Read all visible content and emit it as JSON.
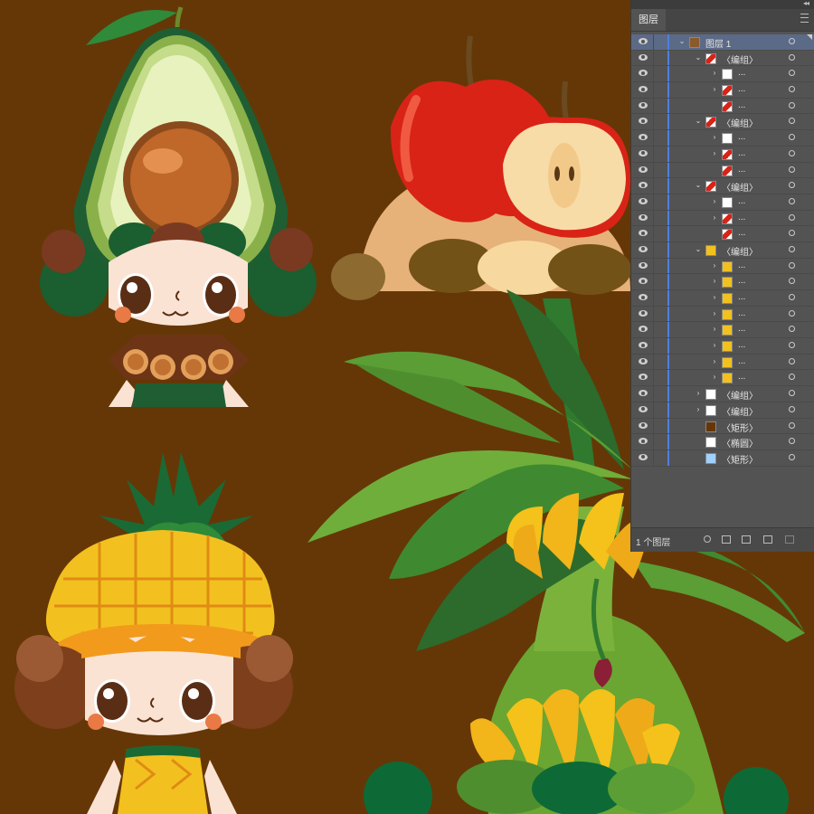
{
  "app": {
    "name": "illustrator-canvas"
  },
  "colors": {
    "background": "#653707",
    "panel": "#535353",
    "accent": "#4f7fe0"
  },
  "layers_panel": {
    "tab_label": "图层",
    "footer_label": "1 个图层",
    "rows": [
      {
        "label": "图层 1",
        "indent": 0,
        "expand": "v",
        "thumb": "layer",
        "top": true
      },
      {
        "label": "〈编组〉",
        "indent": 1,
        "expand": "v",
        "thumb": "red"
      },
      {
        "label": "...",
        "indent": 2,
        "expand": ">",
        "thumb": "white"
      },
      {
        "label": "...",
        "indent": 2,
        "expand": ">",
        "thumb": "red"
      },
      {
        "label": "...",
        "indent": 2,
        "expand": "",
        "thumb": "red"
      },
      {
        "label": "〈编组〉",
        "indent": 1,
        "expand": "v",
        "thumb": "red"
      },
      {
        "label": "...",
        "indent": 2,
        "expand": ">",
        "thumb": "white"
      },
      {
        "label": "...",
        "indent": 2,
        "expand": ">",
        "thumb": "red"
      },
      {
        "label": "...",
        "indent": 2,
        "expand": "",
        "thumb": "red"
      },
      {
        "label": "〈编组〉",
        "indent": 1,
        "expand": "v",
        "thumb": "red"
      },
      {
        "label": "...",
        "indent": 2,
        "expand": ">",
        "thumb": "white"
      },
      {
        "label": "...",
        "indent": 2,
        "expand": ">",
        "thumb": "red"
      },
      {
        "label": "...",
        "indent": 2,
        "expand": "",
        "thumb": "red"
      },
      {
        "label": "〈编组〉",
        "indent": 1,
        "expand": "v",
        "thumb": "char"
      },
      {
        "label": "...",
        "indent": 2,
        "expand": ">",
        "thumb": "char"
      },
      {
        "label": "...",
        "indent": 2,
        "expand": ">",
        "thumb": "char"
      },
      {
        "label": "...",
        "indent": 2,
        "expand": ">",
        "thumb": "char"
      },
      {
        "label": "...",
        "indent": 2,
        "expand": ">",
        "thumb": "char"
      },
      {
        "label": "...",
        "indent": 2,
        "expand": ">",
        "thumb": "char"
      },
      {
        "label": "...",
        "indent": 2,
        "expand": ">",
        "thumb": "char"
      },
      {
        "label": "...",
        "indent": 2,
        "expand": ">",
        "thumb": "char"
      },
      {
        "label": "...",
        "indent": 2,
        "expand": ">",
        "thumb": "char"
      },
      {
        "label": "〈编组〉",
        "indent": 1,
        "expand": ">",
        "thumb": "white"
      },
      {
        "label": "〈编组〉",
        "indent": 1,
        "expand": ">",
        "thumb": "white"
      },
      {
        "label": "〈矩形〉",
        "indent": 1,
        "expand": "",
        "thumb": "brown"
      },
      {
        "label": "〈椭圆〉",
        "indent": 1,
        "expand": "",
        "thumb": "white"
      },
      {
        "label": "〈矩形〉",
        "indent": 1,
        "expand": "",
        "thumb": "blue"
      }
    ]
  }
}
